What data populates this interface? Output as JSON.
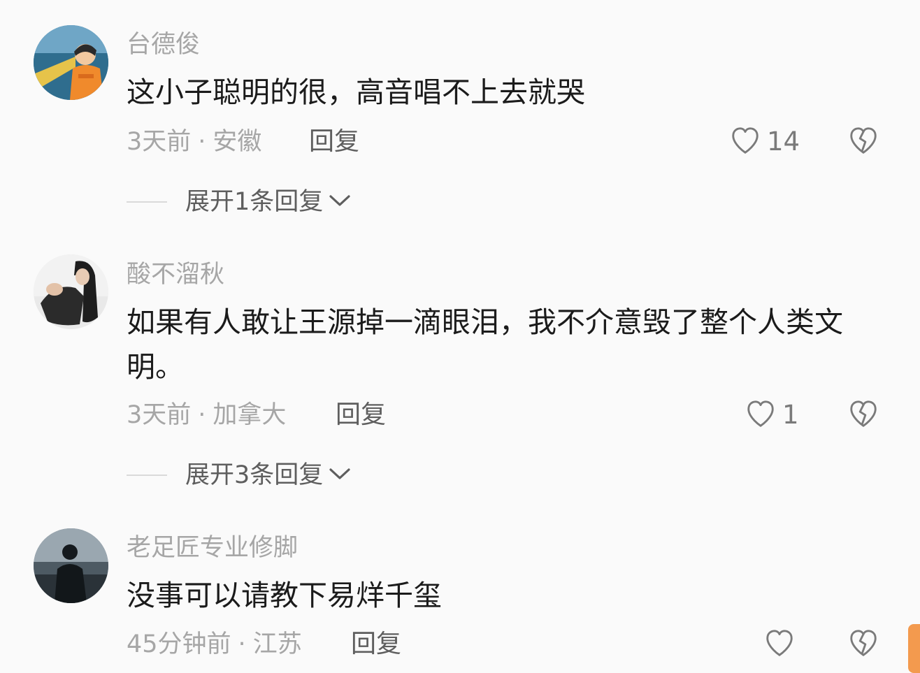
{
  "colors": {
    "background": "#fafafa",
    "username": "#a6a6a6",
    "content": "#1b1b1b",
    "action": "#5e5e5e",
    "accent_scroll": "#f39a4e"
  },
  "comments": [
    {
      "username": "台德俊",
      "content": "这小子聪明的很，高音唱不上去就哭",
      "time": "3天前",
      "separator": "·",
      "location": "安徽",
      "reply_label": "回复",
      "likes": "14",
      "like_icon": "heart-outline-icon",
      "dislike_icon": "broken-heart-icon",
      "expand_label": "展开1条回复"
    },
    {
      "username": "酸不溜秋",
      "content": "如果有人敢让王源掉一滴眼泪，我不介意毁了整个人类文明。",
      "time": "3天前",
      "separator": "·",
      "location": "加拿大",
      "reply_label": "回复",
      "likes": "1",
      "like_icon": "heart-outline-icon",
      "dislike_icon": "broken-heart-icon",
      "expand_label": "展开3条回复"
    },
    {
      "username": "老足匠专业修脚",
      "content": "没事可以请教下易烊千玺",
      "time": "45分钟前",
      "separator": "·",
      "location": "江苏",
      "reply_label": "回复",
      "likes": "",
      "like_icon": "heart-outline-icon",
      "dislike_icon": "broken-heart-icon"
    }
  ]
}
